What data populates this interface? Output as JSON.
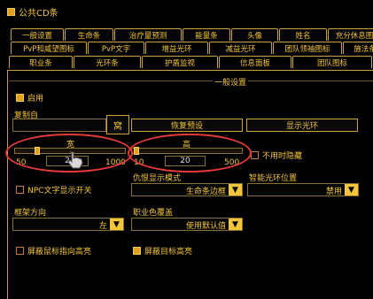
{
  "window": {
    "title": "公共CD条"
  },
  "tabs": {
    "row1": [
      "一般设置",
      "生命条",
      "治疗量预测",
      "能量条",
      "头像",
      "姓名",
      "充分休息图"
    ],
    "row2": [
      "PvP和威望图标",
      "PvP文字",
      "增益光环",
      "减益光环",
      "团队领袖图标",
      "施法条"
    ],
    "row3": [
      "职业条",
      "光环条",
      "护盾监视",
      "信息面板",
      "团队图标"
    ]
  },
  "section": {
    "title": "一般设置"
  },
  "enable": {
    "label": "启用",
    "checked": true
  },
  "replicate": {
    "label": "复制自",
    "confirm_button": "窝",
    "restore_button": "恢复预设",
    "show_aura_button": "显示光环"
  },
  "width_slider": {
    "label": "宽",
    "min": "50",
    "max": "1000",
    "value": "2",
    "level": 0.0
  },
  "height_slider": {
    "label": "高",
    "min": "10",
    "max": "500",
    "value": "20",
    "level": 0.0
  },
  "hide_unused": {
    "label": "不用时隐藏",
    "checked": false
  },
  "npc_text": {
    "label": "NPC文字显示开关",
    "checked": false
  },
  "threat_display": {
    "label": "仇恨显示模式",
    "value": "生命条边框"
  },
  "smart_aura": {
    "label": "智能光环位置",
    "value": "禁用"
  },
  "frame_direction": {
    "label": "框架方向",
    "value": "左"
  },
  "class_color": {
    "label": "职业色覆盖",
    "value": "使用默认值"
  },
  "mouse_highlight": {
    "label": "屏蔽鼠标指向高亮",
    "checked": false
  },
  "target_highlight": {
    "label": "屏蔽目标高亮",
    "checked": true
  },
  "icons": {
    "dropdown": "chevron-down-icon",
    "cursor": "hand-cursor-icon"
  },
  "colors": {
    "accent": "#f3c53c",
    "annotation": "#e43a3a",
    "background": "#000000"
  }
}
